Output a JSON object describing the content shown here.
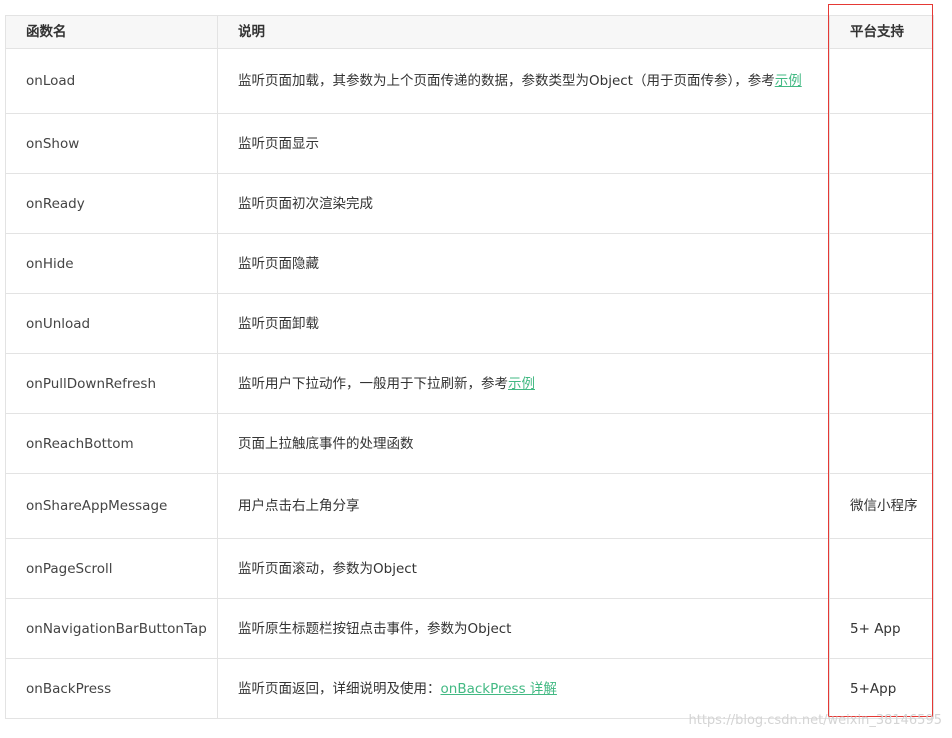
{
  "headers": {
    "name": "函数名",
    "desc": "说明",
    "platform": "平台支持"
  },
  "rows": [
    {
      "name": "onLoad",
      "desc": "监听页面加载，其参数为上个页面传递的数据，参数类型为Object（用于页面传参），参考",
      "link": "示例",
      "platform": ""
    },
    {
      "name": "onShow",
      "desc": "监听页面显示",
      "link": "",
      "platform": ""
    },
    {
      "name": "onReady",
      "desc": "监听页面初次渲染完成",
      "link": "",
      "platform": ""
    },
    {
      "name": "onHide",
      "desc": "监听页面隐藏",
      "link": "",
      "platform": ""
    },
    {
      "name": "onUnload",
      "desc": "监听页面卸载",
      "link": "",
      "platform": ""
    },
    {
      "name": "onPullDownRefresh",
      "desc": "监听用户下拉动作，一般用于下拉刷新，参考",
      "link": "示例",
      "platform": ""
    },
    {
      "name": "onReachBottom",
      "desc": "页面上拉触底事件的处理函数",
      "link": "",
      "platform": ""
    },
    {
      "name": "onShareAppMessage",
      "desc": "用户点击右上角分享",
      "link": "",
      "platform": "微信小程序"
    },
    {
      "name": "onPageScroll",
      "desc": "监听页面滚动，参数为Object",
      "link": "",
      "platform": ""
    },
    {
      "name": "onNavigationBarButtonTap",
      "desc": "监听原生标题栏按钮点击事件，参数为Object",
      "link": "",
      "platform": "5+ App"
    },
    {
      "name": "onBackPress",
      "desc": "监听页面返回，详细说明及使用：",
      "link": "onBackPress 详解",
      "platform": "5+App"
    }
  ],
  "watermark": "https://blog.csdn.net/weixin_38146595",
  "colors": {
    "link": "#42b983",
    "highlight_box": "#e53935"
  }
}
